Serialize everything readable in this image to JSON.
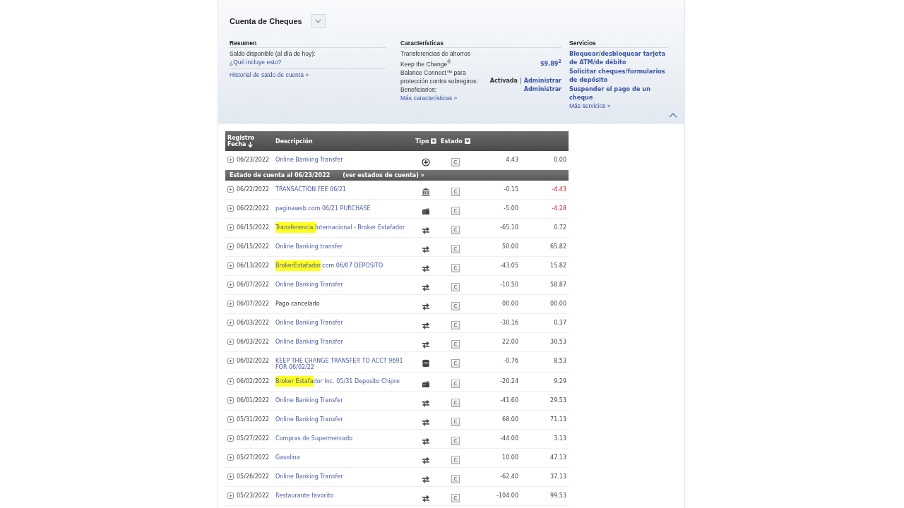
{
  "account": {
    "title": "Cuenta de Cheques",
    "summary": {
      "heading": "Resumen",
      "balance_label": "Saldo disponible (al día de hoy):",
      "help_link": "¿Qué incluye esto?",
      "history_link": "Historial de saldo de cuenta »"
    },
    "features": {
      "heading": "Características",
      "items": [
        {
          "label": "Transferencias de ahorros Keep the Change$^{®}$",
          "value": "$9.89$^{2}$"
        },
        {
          "label": "Balance Connect™ para protección contra sobregiros:",
          "status": "Activada",
          "separator": "|",
          "value": "Administrar"
        },
        {
          "label": "Beneficiarios:",
          "value": "Administrar"
        }
      ],
      "more_link": "Más características »"
    },
    "services": {
      "heading": "Servicios",
      "links": [
        "Bloquear/desbloquear tarjeta de ATM/de débito",
        "Solicitar cheques/formularios de depósito",
        "Suspender el pago de un cheque"
      ],
      "more_link": "Más servicios »"
    },
    "expanded": true
  },
  "table": {
    "columns": {
      "date_top": "Registro",
      "date": "Fecha",
      "description": "Descripción",
      "type": "Tipo",
      "status": "Estado"
    },
    "rows": [
      {
        "kind": "transaction",
        "date": "06/23/2022",
        "description": [
          {
            "text": "Online Banking Transfer",
            "highlighted": false
          }
        ],
        "linked": true,
        "type_icon": {
          "kind": "plus"
        },
        "status": "C",
        "amount": "4.43",
        "balance": "0.00",
        "overdrawn": false
      },
      {
        "kind": "statement",
        "text": "Estado de cuenta al 06/23/2022",
        "link": "(ver estados de cuenta) »"
      },
      {
        "kind": "transaction",
        "date": "06/22/2022",
        "description": [
          {
            "text": "TRANSACTION FEE 06/21",
            "highlighted": false
          }
        ],
        "linked": true,
        "type_icon": {
          "kind": "bank"
        },
        "status": "C",
        "amount": "-0.15",
        "balance": "-4.43",
        "overdrawn": true
      },
      {
        "kind": "transaction",
        "date": "06/22/2022",
        "description": [
          {
            "text": "paginaweb.com 06/21 PURCHASE",
            "highlighted": false
          }
        ],
        "linked": true,
        "type_icon": {
          "kind": "card"
        },
        "status": "C",
        "amount": "-5.00",
        "balance": "-4.28",
        "overdrawn": true
      },
      {
        "kind": "transaction",
        "date": "06/15/2022",
        "description": [
          {
            "text": "Transferencia I",
            "highlighted": true
          },
          {
            "text": "nternacional - Broker Estafador",
            "highlighted": false
          }
        ],
        "linked": true,
        "type_icon": {
          "kind": "transfer"
        },
        "status": "C",
        "amount": "-65.10",
        "balance": "0.72",
        "overdrawn": false
      },
      {
        "kind": "transaction",
        "date": "06/15/2022",
        "description": [
          {
            "text": "Online Banking transfer",
            "highlighted": false
          }
        ],
        "linked": true,
        "type_icon": {
          "kind": "transfer"
        },
        "status": "C",
        "amount": "50.00",
        "balance": "65.82",
        "overdrawn": false
      },
      {
        "kind": "transaction",
        "date": "06/13/2022",
        "description": [
          {
            "text": "BrokerEstafador",
            "highlighted": true
          },
          {
            "text": ".com 06/07 DEPOSITO",
            "highlighted": false
          }
        ],
        "linked": true,
        "type_icon": {
          "kind": "transfer"
        },
        "status": "C",
        "amount": "-43.05",
        "balance": "15.82",
        "overdrawn": false
      },
      {
        "kind": "transaction",
        "date": "06/07/2022",
        "description": [
          {
            "text": "Online Banking Transfer",
            "highlighted": false
          }
        ],
        "linked": true,
        "type_icon": {
          "kind": "transfer"
        },
        "status": "C",
        "amount": "-10.50",
        "balance": "58.87",
        "overdrawn": false
      },
      {
        "kind": "transaction",
        "date": "06/07/2022",
        "description": [
          {
            "text": "Pago cancelado",
            "highlighted": false
          }
        ],
        "linked": false,
        "type_icon": {
          "kind": "transfer"
        },
        "status": "C",
        "amount": "00.00",
        "balance": "00.00",
        "overdrawn": false
      },
      {
        "kind": "transaction",
        "date": "06/03/2022",
        "description": [
          {
            "text": "Online Banking Transfer",
            "highlighted": false
          }
        ],
        "linked": true,
        "type_icon": {
          "kind": "transfer"
        },
        "status": "C",
        "amount": "-30.16",
        "balance": "0.37",
        "overdrawn": false
      },
      {
        "kind": "transaction",
        "date": "06/03/2022",
        "description": [
          {
            "text": "Online Banking Transfer",
            "highlighted": false
          }
        ],
        "linked": true,
        "type_icon": {
          "kind": "transfer"
        },
        "status": "C",
        "amount": "22.00",
        "balance": "30.53",
        "overdrawn": false
      },
      {
        "kind": "transaction",
        "date": "06/02/2022",
        "description": [
          {
            "text": "KEEP THE CHANGE TRANSFER TO ACCT 9691 FOR 06/02/22",
            "highlighted": false
          }
        ],
        "linked": true,
        "type_icon": {
          "kind": "coins"
        },
        "status": "C",
        "amount": "-0.76",
        "balance": "8.53",
        "overdrawn": false
      },
      {
        "kind": "transaction",
        "date": "06/02/2022",
        "description": [
          {
            "text": "Broker Estafa",
            "highlighted": true
          },
          {
            "text": "dor Inc. 05/31 Deposito Chipre",
            "highlighted": false
          }
        ],
        "linked": true,
        "type_icon": {
          "kind": "card"
        },
        "status": "C",
        "amount": "-20.24",
        "balance": "9.29",
        "overdrawn": false
      },
      {
        "kind": "transaction",
        "date": "06/01/2022",
        "description": [
          {
            "text": "Online Banking Transfer",
            "highlighted": false
          }
        ],
        "linked": true,
        "type_icon": {
          "kind": "transfer"
        },
        "status": "C",
        "amount": "-41.60",
        "balance": "29.53",
        "overdrawn": false
      },
      {
        "kind": "transaction",
        "date": "05/31/2022",
        "description": [
          {
            "text": "Online Banking Transfer",
            "highlighted": false
          }
        ],
        "linked": true,
        "type_icon": {
          "kind": "transfer"
        },
        "status": "C",
        "amount": "68.00",
        "balance": "71.13",
        "overdrawn": false
      },
      {
        "kind": "transaction",
        "date": "05/27/2022",
        "description": [
          {
            "text": "Compras de Supermercado",
            "highlighted": false
          }
        ],
        "linked": true,
        "type_icon": {
          "kind": "transfer"
        },
        "status": "C",
        "amount": "-44.00",
        "balance": "3.13",
        "overdrawn": false
      },
      {
        "kind": "transaction",
        "date": "05/27/2022",
        "description": [
          {
            "text": "Gasolina",
            "highlighted": false
          }
        ],
        "linked": true,
        "type_icon": {
          "kind": "transfer"
        },
        "status": "C",
        "amount": "10.00",
        "balance": "47.13",
        "overdrawn": false
      },
      {
        "kind": "transaction",
        "date": "05/26/2022",
        "description": [
          {
            "text": "Online Banking Transfer",
            "highlighted": false
          }
        ],
        "linked": true,
        "type_icon": {
          "kind": "transfer"
        },
        "status": "C",
        "amount": "-62.40",
        "balance": "37.13",
        "overdrawn": false
      },
      {
        "kind": "transaction",
        "date": "05/23/2022",
        "description": [
          {
            "text": "Restaurante favorito",
            "highlighted": false
          }
        ],
        "linked": true,
        "type_icon": {
          "kind": "transfer"
        },
        "status": "C",
        "amount": "-104.00",
        "balance": "99.53",
        "overdrawn": false
      }
    ]
  }
}
